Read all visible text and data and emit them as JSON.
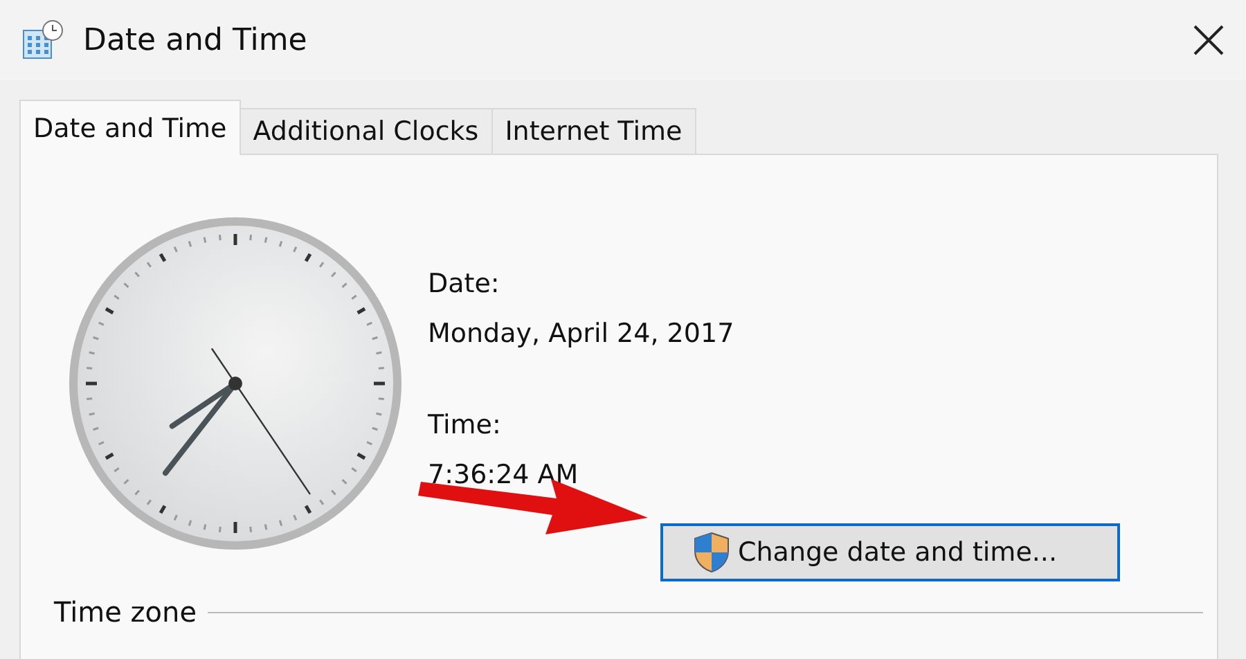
{
  "window": {
    "title": "Date and Time"
  },
  "tabs": [
    {
      "label": "Date and Time",
      "selected": true
    },
    {
      "label": "Additional Clocks",
      "selected": false
    },
    {
      "label": "Internet Time",
      "selected": false
    }
  ],
  "date": {
    "label": "Date:",
    "value": "Monday, April 24, 2017"
  },
  "time": {
    "label": "Time:",
    "value": "7:36:24 AM"
  },
  "change_button": {
    "label": "Change date and time..."
  },
  "time_zone": {
    "label": "Time zone"
  }
}
